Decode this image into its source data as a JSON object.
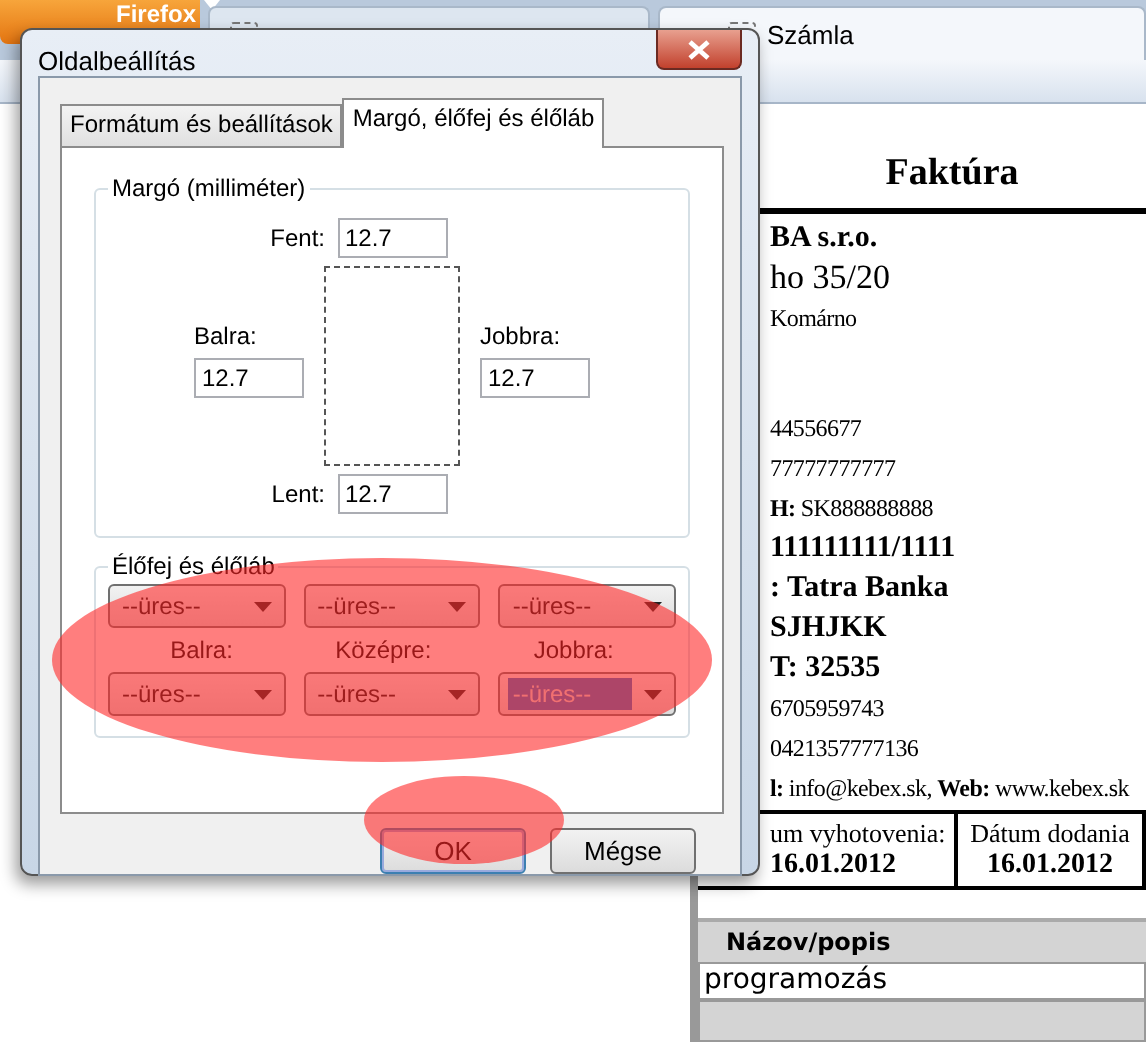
{
  "browser": {
    "menu_button": "Firefox",
    "tabs": [
      {
        "selected": false
      },
      {
        "label": "Számla",
        "selected": true
      }
    ]
  },
  "invoice": {
    "title": "Faktúra",
    "lines": [
      {
        "text": "BA s.r.o.",
        "kind": "bold"
      },
      {
        "text": "ho 35/20",
        "kind": "large"
      },
      {
        "text": "Komárno",
        "kind": "small"
      },
      {
        "kind": "gap"
      },
      {
        "text": "44556677",
        "kind": "small"
      },
      {
        "text": "77777777777",
        "kind": "small"
      },
      {
        "text": "**H:** SK888888888",
        "kind": "small"
      },
      {
        "text": "111111111/1111",
        "kind": "bold"
      },
      {
        "text": ": Tatra Banka",
        "kind": "bold"
      },
      {
        "text": "SJHJKK",
        "kind": "bold"
      },
      {
        "text": "T: 32535",
        "kind": "bold"
      },
      {
        "text": "6705959743",
        "kind": "small"
      },
      {
        "text": "0421357777136",
        "kind": "small"
      },
      {
        "text": "**l:** info@kebex.sk, **Web:** www.kebex.sk",
        "kind": "small"
      }
    ],
    "dates": [
      {
        "label": "um vyhotovenia:",
        "value": "16.01.2012"
      },
      {
        "label": "Dátum dodania",
        "value": "16.01.2012"
      }
    ],
    "items": {
      "header": "Názov/popis",
      "rows": [
        "programozás",
        ""
      ]
    }
  },
  "dialog": {
    "title": "Oldalbeállítás",
    "tabs": [
      {
        "label": "Formátum és beállítások",
        "selected": false
      },
      {
        "label": "Margó, élőfej és élőláb",
        "selected": true
      }
    ],
    "margins": {
      "legend": "Margó (milliméter)",
      "top": {
        "label": "Fent:",
        "value": "12.7"
      },
      "left": {
        "label": "Balra:",
        "value": "12.7"
      },
      "right": {
        "label": "Jobbra:",
        "value": "12.7"
      },
      "bottom": {
        "label": "Lent:",
        "value": "12.7"
      }
    },
    "header_footer": {
      "legend": "Élőfej és élőláb",
      "headers": [
        {
          "value": "--üres--",
          "focused": false
        },
        {
          "value": "--üres--",
          "focused": false
        },
        {
          "value": "--üres--",
          "focused": false
        }
      ],
      "labels": [
        "Balra:",
        "Középre:",
        "Jobbra:"
      ],
      "footers": [
        {
          "value": "--üres--",
          "focused": false
        },
        {
          "value": "--üres--",
          "focused": false
        },
        {
          "value": "--üres--",
          "focused": true
        }
      ]
    },
    "buttons": [
      {
        "label": "OK",
        "focused": true
      },
      {
        "label": "Mégse",
        "focused": false
      }
    ]
  }
}
